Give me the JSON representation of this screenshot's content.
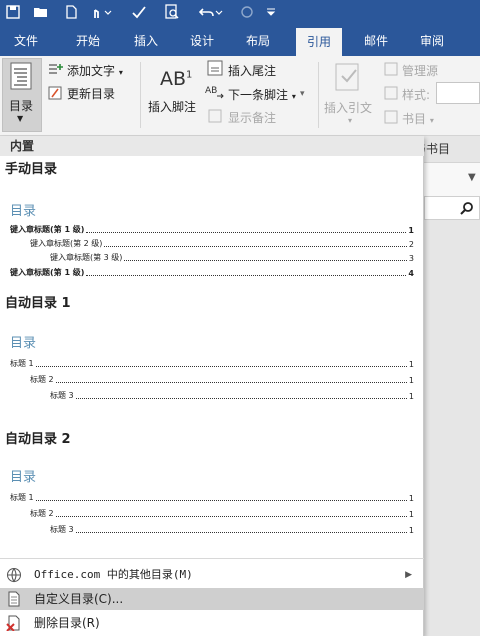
{
  "ribbon_tabs": [
    "文件",
    "开始",
    "插入",
    "设计",
    "布局",
    "引用",
    "邮件",
    "审阅"
  ],
  "active_tab": "引用",
  "toc_group": {
    "toc_label": "目录",
    "add_text": "添加文字",
    "update_toc": "更新目录"
  },
  "footnotes_group": {
    "ab_glyph": "AB",
    "ab_sup": "1",
    "insert_footnote": "插入脚注",
    "insert_endnote": "插入尾注",
    "next_footnote": "下一条脚注",
    "show_notes": "显示备注"
  },
  "citations_group": {
    "insert_citation": "插入引文",
    "manage_sources": "管理源",
    "style": "样式:",
    "bibliography": "书目"
  },
  "section_partial": "与书目",
  "gallery": {
    "header": "内置",
    "thumb1": {
      "title": "手动目录",
      "toc_heading": "目录",
      "entries": [
        {
          "text": "键入章标题(第 1 级)",
          "page": "1"
        },
        {
          "text": "键入章标题(第 2 级)",
          "page": "2"
        },
        {
          "text": "键入章标题(第 3 级)",
          "page": "3"
        },
        {
          "text": "键入章标题(第 1 级)",
          "page": "4"
        }
      ]
    },
    "thumb2": {
      "title": "自动目录 1",
      "toc_heading": "目录",
      "entries": [
        {
          "text": "标题 1",
          "page": "1"
        },
        {
          "text": "标题 2",
          "page": "1"
        },
        {
          "text": "标题 3",
          "page": "1"
        }
      ]
    },
    "thumb3": {
      "title": "自动目录 2",
      "toc_heading": "目录",
      "entries": [
        {
          "text": "标题 1",
          "page": "1"
        },
        {
          "text": "标题 2",
          "page": "1"
        },
        {
          "text": "标题 3",
          "page": "1"
        }
      ]
    },
    "menu": {
      "office_more": "Office.com 中的其他目录(M)",
      "custom_toc": "自定义目录(C)...",
      "remove_toc": "删除目录(R)"
    }
  },
  "colors": {
    "title_bar": "#2b579a",
    "ribbon": "#f3f3f3",
    "toc_heading": "#5b8fb3",
    "hover": "#cfcfcf"
  }
}
